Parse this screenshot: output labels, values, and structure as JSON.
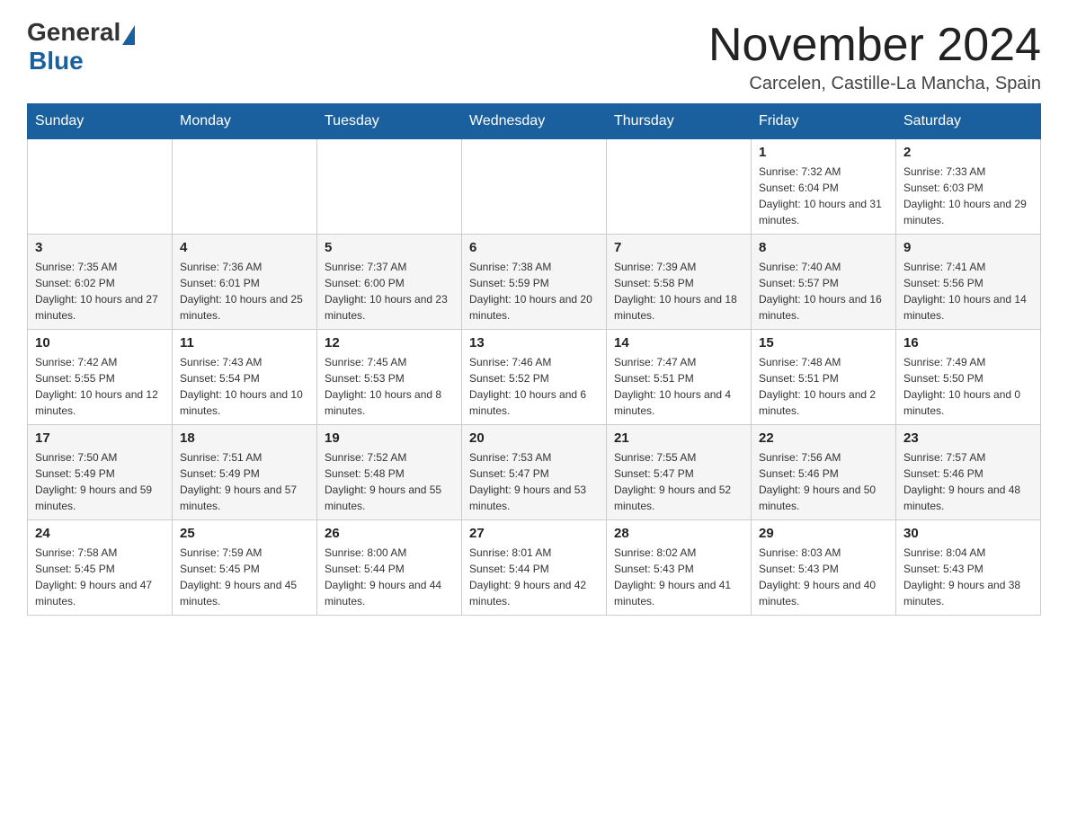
{
  "header": {
    "logo_general": "General",
    "logo_blue": "Blue",
    "month_title": "November 2024",
    "subtitle": "Carcelen, Castille-La Mancha, Spain"
  },
  "weekdays": [
    "Sunday",
    "Monday",
    "Tuesday",
    "Wednesday",
    "Thursday",
    "Friday",
    "Saturday"
  ],
  "weeks": [
    [
      {
        "day": "",
        "info": ""
      },
      {
        "day": "",
        "info": ""
      },
      {
        "day": "",
        "info": ""
      },
      {
        "day": "",
        "info": ""
      },
      {
        "day": "",
        "info": ""
      },
      {
        "day": "1",
        "info": "Sunrise: 7:32 AM\nSunset: 6:04 PM\nDaylight: 10 hours and 31 minutes."
      },
      {
        "day": "2",
        "info": "Sunrise: 7:33 AM\nSunset: 6:03 PM\nDaylight: 10 hours and 29 minutes."
      }
    ],
    [
      {
        "day": "3",
        "info": "Sunrise: 7:35 AM\nSunset: 6:02 PM\nDaylight: 10 hours and 27 minutes."
      },
      {
        "day": "4",
        "info": "Sunrise: 7:36 AM\nSunset: 6:01 PM\nDaylight: 10 hours and 25 minutes."
      },
      {
        "day": "5",
        "info": "Sunrise: 7:37 AM\nSunset: 6:00 PM\nDaylight: 10 hours and 23 minutes."
      },
      {
        "day": "6",
        "info": "Sunrise: 7:38 AM\nSunset: 5:59 PM\nDaylight: 10 hours and 20 minutes."
      },
      {
        "day": "7",
        "info": "Sunrise: 7:39 AM\nSunset: 5:58 PM\nDaylight: 10 hours and 18 minutes."
      },
      {
        "day": "8",
        "info": "Sunrise: 7:40 AM\nSunset: 5:57 PM\nDaylight: 10 hours and 16 minutes."
      },
      {
        "day": "9",
        "info": "Sunrise: 7:41 AM\nSunset: 5:56 PM\nDaylight: 10 hours and 14 minutes."
      }
    ],
    [
      {
        "day": "10",
        "info": "Sunrise: 7:42 AM\nSunset: 5:55 PM\nDaylight: 10 hours and 12 minutes."
      },
      {
        "day": "11",
        "info": "Sunrise: 7:43 AM\nSunset: 5:54 PM\nDaylight: 10 hours and 10 minutes."
      },
      {
        "day": "12",
        "info": "Sunrise: 7:45 AM\nSunset: 5:53 PM\nDaylight: 10 hours and 8 minutes."
      },
      {
        "day": "13",
        "info": "Sunrise: 7:46 AM\nSunset: 5:52 PM\nDaylight: 10 hours and 6 minutes."
      },
      {
        "day": "14",
        "info": "Sunrise: 7:47 AM\nSunset: 5:51 PM\nDaylight: 10 hours and 4 minutes."
      },
      {
        "day": "15",
        "info": "Sunrise: 7:48 AM\nSunset: 5:51 PM\nDaylight: 10 hours and 2 minutes."
      },
      {
        "day": "16",
        "info": "Sunrise: 7:49 AM\nSunset: 5:50 PM\nDaylight: 10 hours and 0 minutes."
      }
    ],
    [
      {
        "day": "17",
        "info": "Sunrise: 7:50 AM\nSunset: 5:49 PM\nDaylight: 9 hours and 59 minutes."
      },
      {
        "day": "18",
        "info": "Sunrise: 7:51 AM\nSunset: 5:49 PM\nDaylight: 9 hours and 57 minutes."
      },
      {
        "day": "19",
        "info": "Sunrise: 7:52 AM\nSunset: 5:48 PM\nDaylight: 9 hours and 55 minutes."
      },
      {
        "day": "20",
        "info": "Sunrise: 7:53 AM\nSunset: 5:47 PM\nDaylight: 9 hours and 53 minutes."
      },
      {
        "day": "21",
        "info": "Sunrise: 7:55 AM\nSunset: 5:47 PM\nDaylight: 9 hours and 52 minutes."
      },
      {
        "day": "22",
        "info": "Sunrise: 7:56 AM\nSunset: 5:46 PM\nDaylight: 9 hours and 50 minutes."
      },
      {
        "day": "23",
        "info": "Sunrise: 7:57 AM\nSunset: 5:46 PM\nDaylight: 9 hours and 48 minutes."
      }
    ],
    [
      {
        "day": "24",
        "info": "Sunrise: 7:58 AM\nSunset: 5:45 PM\nDaylight: 9 hours and 47 minutes."
      },
      {
        "day": "25",
        "info": "Sunrise: 7:59 AM\nSunset: 5:45 PM\nDaylight: 9 hours and 45 minutes."
      },
      {
        "day": "26",
        "info": "Sunrise: 8:00 AM\nSunset: 5:44 PM\nDaylight: 9 hours and 44 minutes."
      },
      {
        "day": "27",
        "info": "Sunrise: 8:01 AM\nSunset: 5:44 PM\nDaylight: 9 hours and 42 minutes."
      },
      {
        "day": "28",
        "info": "Sunrise: 8:02 AM\nSunset: 5:43 PM\nDaylight: 9 hours and 41 minutes."
      },
      {
        "day": "29",
        "info": "Sunrise: 8:03 AM\nSunset: 5:43 PM\nDaylight: 9 hours and 40 minutes."
      },
      {
        "day": "30",
        "info": "Sunrise: 8:04 AM\nSunset: 5:43 PM\nDaylight: 9 hours and 38 minutes."
      }
    ]
  ]
}
